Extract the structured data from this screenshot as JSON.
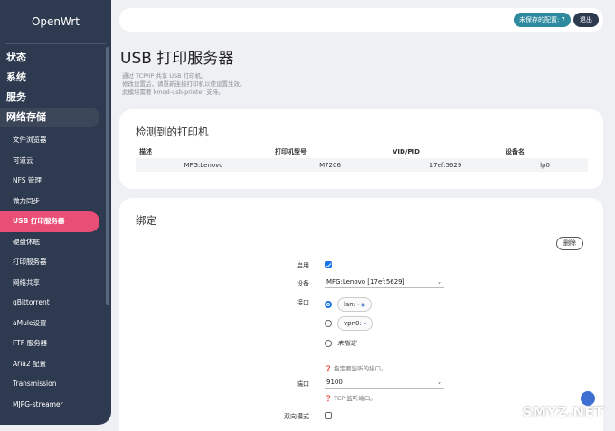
{
  "brand": "OpenWrt",
  "sidebar": {
    "top_items": [
      "状态",
      "系统",
      "服务",
      "网络存储"
    ],
    "sub_items": [
      "文件浏览器",
      "可道云",
      "NFS 管理",
      "微力同步",
      "USB 打印服务器",
      "硬盘休眠",
      "打印服务器",
      "网络共享",
      "qBittorrent",
      "aMule设置",
      "FTP 服务器",
      "Aria2 配置",
      "Transmission",
      "MJPG-streamer"
    ],
    "active_index": 4
  },
  "header": {
    "unsaved_label": "未保存的配置: 7",
    "logout_label": "退出"
  },
  "page": {
    "title": "USB 打印服务器",
    "desc_lines": [
      "通过 TCP/IP 共享 USB 打印机。",
      "修改设置后，请重新连接打印机以使设置生效。",
      "此模块需要 kmod-usb-printer 支持。"
    ]
  },
  "detected": {
    "title": "检测到的打印机",
    "columns": [
      "描述",
      "打印机型号",
      "VID/PID",
      "设备名"
    ],
    "rows": [
      [
        "MFG:Lenovo",
        "M7206",
        "17ef:5629",
        "lp0"
      ]
    ]
  },
  "binding": {
    "title": "绑定",
    "delete_label": "删除",
    "enable_label": "启用",
    "device_label": "设备",
    "device_value": "MFG:Lenovo [17ef:5629]",
    "iface_label": "接口",
    "iface_options": [
      "lan:",
      "vpn0:",
      "未指定"
    ],
    "iface_hint": "指定要监听的接口。",
    "port_label": "端口",
    "port_value": "9100",
    "port_hint": "TCP 监听端口。",
    "bidir_label": "双向模式"
  },
  "watermark": "SMYZ.NET",
  "colors": {
    "sidebar_bg": "#2e3a4f",
    "active_item": "#e94e77",
    "unsaved_badge": "#2d8a9e",
    "checkbox": "#1a73e8"
  }
}
